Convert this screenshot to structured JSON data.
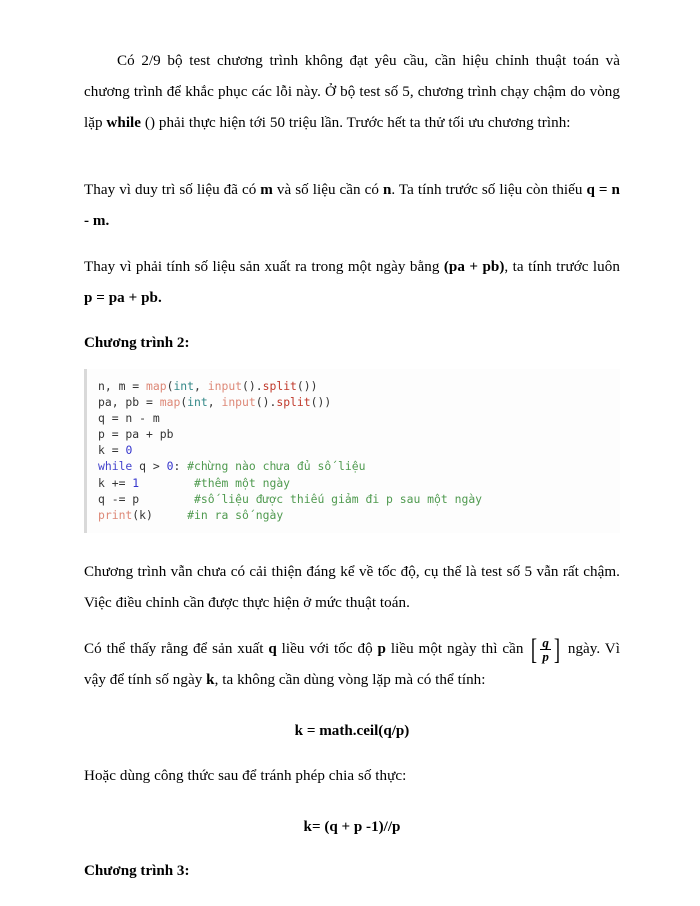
{
  "document": {
    "paragraph_1": "Có 2/9 bộ test chương trình không đạt yêu cầu, cần hiệu chỉnh thuật toán và chương trình để khắc phục các lỗi này. Ở bộ test số 5, chương trình chạy chậm do vòng lặp ",
    "paragraph_1_bold": "while",
    "paragraph_1_tail": " () phải thực hiện tới 50 triệu lần. Trước hết ta thử tối ưu chương trình:",
    "paragraph_2_a": "Thay vì duy trì số liệu đã có ",
    "paragraph_2_b1": "m",
    "paragraph_2_c": " và số liệu cần có ",
    "paragraph_2_b2": "n",
    "paragraph_2_d": ". Ta tính trước số liệu còn thiếu ",
    "paragraph_2_b3": "q = n - m.",
    "paragraph_3_a": "Thay vì phải tính số liệu sản xuất ra trong một ngày bằng ",
    "paragraph_3_b1": "(pa + pb)",
    "paragraph_3_c": ", ta tính trước luôn ",
    "paragraph_3_b2": "p = pa + pb.",
    "heading_program_2": "Chương trình 2:",
    "code": {
      "line1": {
        "p1": "n, m = ",
        "fn": "map",
        "p2": "(",
        "builtin": "int",
        "p3": ", ",
        "fn2": "input",
        "p4": "().",
        "method": "split",
        "p5": "())"
      },
      "line2": {
        "p1": "pa, pb = ",
        "fn": "map",
        "p2": "(",
        "builtin": "int",
        "p3": ", ",
        "fn2": "input",
        "p4": "().",
        "method": "split",
        "p5": "())"
      },
      "line3": "q = n - m",
      "line4": "p = pa + pb",
      "line5": {
        "p1": "k = ",
        "num": "0"
      },
      "line6": {
        "kw": "while",
        "p1": " q > ",
        "num": "0",
        "p2": ": ",
        "comment": "#chừng nào chưa đủ số liệu"
      },
      "line7": {
        "p1": "k += ",
        "num": "1",
        "p2": "        ",
        "comment": "#thêm một ngày"
      },
      "line8": {
        "p1": "q -= p        ",
        "comment": "#số liệu được thiếu giảm đi p sau một ngày"
      },
      "line9": {
        "fn": "print",
        "p1": "(k)     ",
        "comment": "#in ra số ngày"
      }
    },
    "paragraph_4": "Chương trình vẫn chưa có cải thiện đáng kể về tốc độ, cụ thể là test số 5 vẫn rất chậm. Việc điều chỉnh cần được thực hiện ở mức thuật toán.",
    "paragraph_5_a": "Có thể thấy rằng để sản xuất ",
    "paragraph_5_b1": "q",
    "paragraph_5_c": " liều với tốc độ ",
    "paragraph_5_b2": "p",
    "paragraph_5_d": " liều một ngày thì cần ",
    "fraction_numerator": "q",
    "fraction_denominator": "p",
    "bracket_left": "[",
    "bracket_right": "]",
    "paragraph_5_e": " ngày. Vì vậy để tính số ngày ",
    "paragraph_5_b3": "k",
    "paragraph_5_f": ", ta không cần dùng vòng lặp mà có thể tính:",
    "formula_1": "k = math.ceil(q/p)",
    "paragraph_6": "Hoặc dùng công thức sau để tránh phép chia số thực:",
    "formula_2": "k= (q + p -1)//p",
    "heading_program_3": "Chương trình 3:"
  }
}
